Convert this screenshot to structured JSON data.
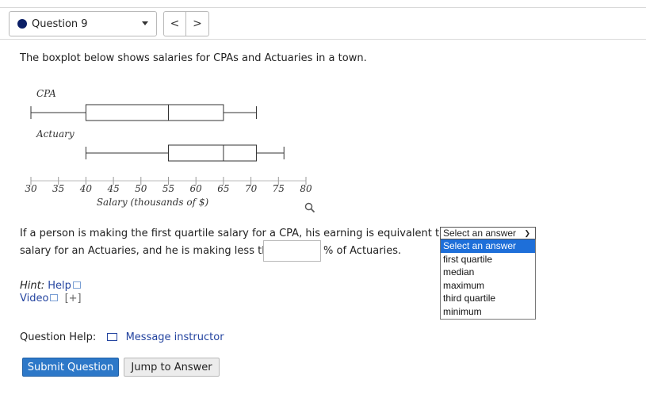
{
  "header": {
    "question_label": "Question 9",
    "prev_glyph": "<",
    "next_glyph": ">"
  },
  "prompt": "The boxplot below shows salaries for CPAs and Actuaries in a town.",
  "chart_data": {
    "type": "boxplot",
    "xlabel": "Salary (thousands of $)",
    "ticks": [
      30,
      35,
      40,
      45,
      50,
      55,
      60,
      65,
      70,
      75,
      80
    ],
    "xlim": [
      30,
      80
    ],
    "series": [
      {
        "name": "CPA",
        "min": 30,
        "q1": 40,
        "median": 55,
        "q3": 65,
        "max": 71
      },
      {
        "name": "Actuary",
        "min": 40,
        "q1": 55,
        "median": 65,
        "q3": 71,
        "max": 76
      }
    ]
  },
  "question": {
    "line1": "If a person is making the first quartile salary for a CPA, his earning is equivalent to the",
    "line2_prefix": "salary for an Actuaries, and he is making less than",
    "line2_suffix": "% of Actuaries."
  },
  "dropdown": {
    "selected": "Select an answer",
    "options": [
      "Select an answer",
      "first quartile",
      "median",
      "maximum",
      "third quartile",
      "minimum"
    ]
  },
  "hint": {
    "label": "Hint:",
    "help_link": "Help",
    "video_link": "Video",
    "expand": "[+]"
  },
  "help": {
    "label": "Question Help:",
    "message_link": "Message instructor"
  },
  "buttons": {
    "submit": "Submit Question",
    "jump": "Jump to Answer"
  }
}
